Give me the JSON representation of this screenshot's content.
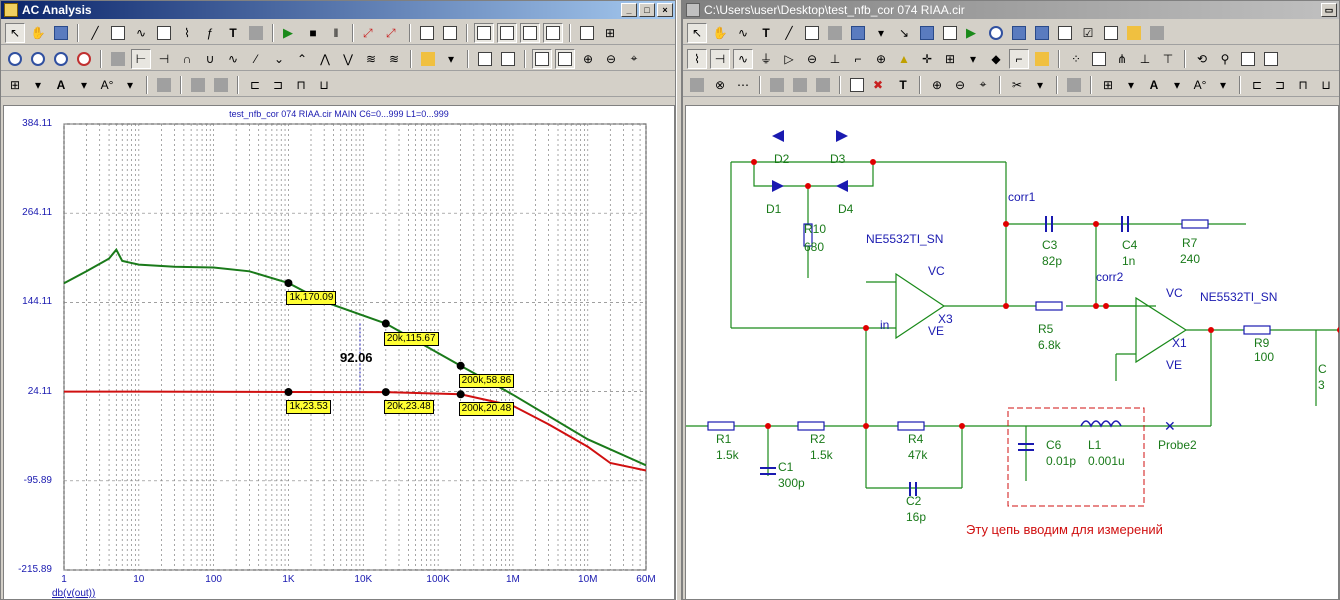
{
  "left_window": {
    "title": "AC Analysis",
    "plot_title": "test_nfb_cor 074 RIAA.cir MAIN C6=0...999 L1=0...999",
    "y_ticks": [
      "384.11",
      "264.11",
      "144.11",
      "24.11",
      "-95.89",
      "-215.89"
    ],
    "x_ticks": [
      "1",
      "10",
      "100",
      "1K",
      "10K",
      "100K",
      "1M",
      "10M",
      "60M"
    ],
    "y_axis_expr": "db(v(out))",
    "delta_label": "92.06"
  },
  "right_window": {
    "title": "C:\\Users\\user\\Desktop\\test_nfb_cor 074 RIAA.cir",
    "note_text": "Эту цепь вводим для измерений"
  },
  "chart_data": {
    "type": "line",
    "xscale": "log",
    "xlim": [
      1,
      60000000
    ],
    "ylim": [
      -215.89,
      384.11
    ],
    "xlabel": "",
    "ylabel": "db(v(out))",
    "grid": true,
    "series": [
      {
        "color": "#1a7a1a",
        "points": [
          [
            1,
            170
          ],
          [
            2,
            186
          ],
          [
            4,
            203
          ],
          [
            5,
            215
          ],
          [
            6,
            200
          ],
          [
            10,
            195
          ],
          [
            30,
            192
          ],
          [
            100,
            191
          ],
          [
            300,
            186
          ],
          [
            1000,
            170.09
          ],
          [
            3000,
            145
          ],
          [
            20000,
            115.67
          ],
          [
            200000,
            58.86
          ],
          [
            1000000,
            20
          ],
          [
            10000000,
            -40
          ],
          [
            60000000,
            -75
          ]
        ]
      },
      {
        "color": "#d01010",
        "points": [
          [
            1,
            24.11
          ],
          [
            10,
            24.11
          ],
          [
            1000,
            23.53
          ],
          [
            20000,
            23.48
          ],
          [
            200000,
            20.48
          ],
          [
            1000000,
            5
          ],
          [
            3000000,
            -20
          ],
          [
            10000000,
            -50
          ],
          [
            20000000,
            -72
          ],
          [
            60000000,
            -82
          ]
        ]
      }
    ],
    "annotations": [
      {
        "label": "1k,170.09",
        "x": 1000,
        "y": 170.09
      },
      {
        "label": "20k,115.67",
        "x": 20000,
        "y": 115.67
      },
      {
        "label": "200k,58.86",
        "x": 200000,
        "y": 58.86
      },
      {
        "label": "1k,23.53",
        "x": 1000,
        "y": 23.53
      },
      {
        "label": "20k,23.48",
        "x": 20000,
        "y": 23.48
      },
      {
        "label": "200k,20.48",
        "x": 200000,
        "y": 20.48
      }
    ]
  },
  "schematic": {
    "labels": [
      {
        "t": "D2",
        "c": "green"
      },
      {
        "t": "D3",
        "c": "green"
      },
      {
        "t": "D1",
        "c": "green"
      },
      {
        "t": "D4",
        "c": "green"
      },
      {
        "t": "R10",
        "c": "green"
      },
      {
        "t": "680",
        "c": "green"
      },
      {
        "t": "NE5532TI_SN",
        "c": "blue"
      },
      {
        "t": "corr1",
        "c": "blue"
      },
      {
        "t": "C3",
        "c": "green"
      },
      {
        "t": "82p",
        "c": "green"
      },
      {
        "t": "C4",
        "c": "green"
      },
      {
        "t": "1n",
        "c": "green"
      },
      {
        "t": "R7",
        "c": "green"
      },
      {
        "t": "240",
        "c": "green"
      },
      {
        "t": "corr2",
        "c": "blue"
      },
      {
        "t": "NE5532TI_SN",
        "c": "blue"
      },
      {
        "t": "VC",
        "c": "blue"
      },
      {
        "t": "VE",
        "c": "blue"
      },
      {
        "t": "X3",
        "c": "blue"
      },
      {
        "t": "in",
        "c": "blue"
      },
      {
        "t": "R5",
        "c": "green"
      },
      {
        "t": "6.8k",
        "c": "green"
      },
      {
        "t": "VC",
        "c": "blue"
      },
      {
        "t": "VE",
        "c": "blue"
      },
      {
        "t": "X1",
        "c": "blue"
      },
      {
        "t": "R9",
        "c": "green"
      },
      {
        "t": "100",
        "c": "green"
      },
      {
        "t": "C",
        "c": "green"
      },
      {
        "t": "3",
        "c": "green"
      },
      {
        "t": "R1",
        "c": "green"
      },
      {
        "t": "1.5k",
        "c": "green"
      },
      {
        "t": "R2",
        "c": "green"
      },
      {
        "t": "1.5k",
        "c": "green"
      },
      {
        "t": "C1",
        "c": "green"
      },
      {
        "t": "300p",
        "c": "green"
      },
      {
        "t": "R4",
        "c": "green"
      },
      {
        "t": "47k",
        "c": "green"
      },
      {
        "t": "C2",
        "c": "green"
      },
      {
        "t": "16p",
        "c": "green"
      },
      {
        "t": "C6",
        "c": "green"
      },
      {
        "t": "0.01p",
        "c": "green"
      },
      {
        "t": "L1",
        "c": "green"
      },
      {
        "t": "0.001u",
        "c": "green"
      },
      {
        "t": "Probe2",
        "c": "green"
      }
    ]
  }
}
